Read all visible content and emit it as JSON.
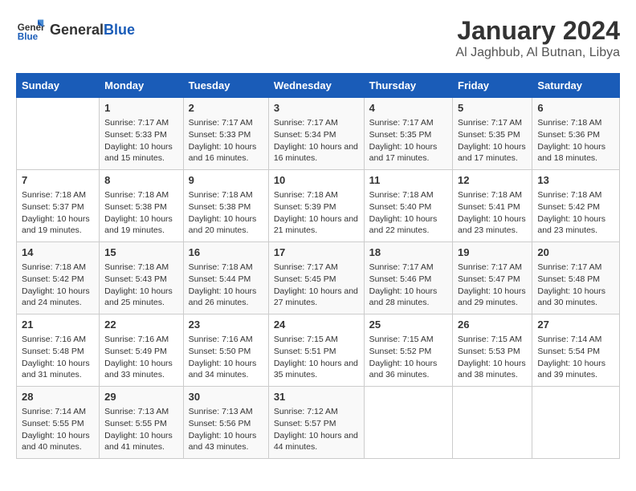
{
  "logo": {
    "text_general": "General",
    "text_blue": "Blue"
  },
  "title": "January 2024",
  "subtitle": "Al Jaghbub, Al Butnan, Libya",
  "header_days": [
    "Sunday",
    "Monday",
    "Tuesday",
    "Wednesday",
    "Thursday",
    "Friday",
    "Saturday"
  ],
  "weeks": [
    [
      {
        "day": "",
        "sunrise": "",
        "sunset": "",
        "daylight": ""
      },
      {
        "day": "1",
        "sunrise": "Sunrise: 7:17 AM",
        "sunset": "Sunset: 5:33 PM",
        "daylight": "Daylight: 10 hours and 15 minutes."
      },
      {
        "day": "2",
        "sunrise": "Sunrise: 7:17 AM",
        "sunset": "Sunset: 5:33 PM",
        "daylight": "Daylight: 10 hours and 16 minutes."
      },
      {
        "day": "3",
        "sunrise": "Sunrise: 7:17 AM",
        "sunset": "Sunset: 5:34 PM",
        "daylight": "Daylight: 10 hours and 16 minutes."
      },
      {
        "day": "4",
        "sunrise": "Sunrise: 7:17 AM",
        "sunset": "Sunset: 5:35 PM",
        "daylight": "Daylight: 10 hours and 17 minutes."
      },
      {
        "day": "5",
        "sunrise": "Sunrise: 7:17 AM",
        "sunset": "Sunset: 5:35 PM",
        "daylight": "Daylight: 10 hours and 17 minutes."
      },
      {
        "day": "6",
        "sunrise": "Sunrise: 7:18 AM",
        "sunset": "Sunset: 5:36 PM",
        "daylight": "Daylight: 10 hours and 18 minutes."
      }
    ],
    [
      {
        "day": "7",
        "sunrise": "Sunrise: 7:18 AM",
        "sunset": "Sunset: 5:37 PM",
        "daylight": "Daylight: 10 hours and 19 minutes."
      },
      {
        "day": "8",
        "sunrise": "Sunrise: 7:18 AM",
        "sunset": "Sunset: 5:38 PM",
        "daylight": "Daylight: 10 hours and 19 minutes."
      },
      {
        "day": "9",
        "sunrise": "Sunrise: 7:18 AM",
        "sunset": "Sunset: 5:38 PM",
        "daylight": "Daylight: 10 hours and 20 minutes."
      },
      {
        "day": "10",
        "sunrise": "Sunrise: 7:18 AM",
        "sunset": "Sunset: 5:39 PM",
        "daylight": "Daylight: 10 hours and 21 minutes."
      },
      {
        "day": "11",
        "sunrise": "Sunrise: 7:18 AM",
        "sunset": "Sunset: 5:40 PM",
        "daylight": "Daylight: 10 hours and 22 minutes."
      },
      {
        "day": "12",
        "sunrise": "Sunrise: 7:18 AM",
        "sunset": "Sunset: 5:41 PM",
        "daylight": "Daylight: 10 hours and 23 minutes."
      },
      {
        "day": "13",
        "sunrise": "Sunrise: 7:18 AM",
        "sunset": "Sunset: 5:42 PM",
        "daylight": "Daylight: 10 hours and 23 minutes."
      }
    ],
    [
      {
        "day": "14",
        "sunrise": "Sunrise: 7:18 AM",
        "sunset": "Sunset: 5:42 PM",
        "daylight": "Daylight: 10 hours and 24 minutes."
      },
      {
        "day": "15",
        "sunrise": "Sunrise: 7:18 AM",
        "sunset": "Sunset: 5:43 PM",
        "daylight": "Daylight: 10 hours and 25 minutes."
      },
      {
        "day": "16",
        "sunrise": "Sunrise: 7:18 AM",
        "sunset": "Sunset: 5:44 PM",
        "daylight": "Daylight: 10 hours and 26 minutes."
      },
      {
        "day": "17",
        "sunrise": "Sunrise: 7:17 AM",
        "sunset": "Sunset: 5:45 PM",
        "daylight": "Daylight: 10 hours and 27 minutes."
      },
      {
        "day": "18",
        "sunrise": "Sunrise: 7:17 AM",
        "sunset": "Sunset: 5:46 PM",
        "daylight": "Daylight: 10 hours and 28 minutes."
      },
      {
        "day": "19",
        "sunrise": "Sunrise: 7:17 AM",
        "sunset": "Sunset: 5:47 PM",
        "daylight": "Daylight: 10 hours and 29 minutes."
      },
      {
        "day": "20",
        "sunrise": "Sunrise: 7:17 AM",
        "sunset": "Sunset: 5:48 PM",
        "daylight": "Daylight: 10 hours and 30 minutes."
      }
    ],
    [
      {
        "day": "21",
        "sunrise": "Sunrise: 7:16 AM",
        "sunset": "Sunset: 5:48 PM",
        "daylight": "Daylight: 10 hours and 31 minutes."
      },
      {
        "day": "22",
        "sunrise": "Sunrise: 7:16 AM",
        "sunset": "Sunset: 5:49 PM",
        "daylight": "Daylight: 10 hours and 33 minutes."
      },
      {
        "day": "23",
        "sunrise": "Sunrise: 7:16 AM",
        "sunset": "Sunset: 5:50 PM",
        "daylight": "Daylight: 10 hours and 34 minutes."
      },
      {
        "day": "24",
        "sunrise": "Sunrise: 7:15 AM",
        "sunset": "Sunset: 5:51 PM",
        "daylight": "Daylight: 10 hours and 35 minutes."
      },
      {
        "day": "25",
        "sunrise": "Sunrise: 7:15 AM",
        "sunset": "Sunset: 5:52 PM",
        "daylight": "Daylight: 10 hours and 36 minutes."
      },
      {
        "day": "26",
        "sunrise": "Sunrise: 7:15 AM",
        "sunset": "Sunset: 5:53 PM",
        "daylight": "Daylight: 10 hours and 38 minutes."
      },
      {
        "day": "27",
        "sunrise": "Sunrise: 7:14 AM",
        "sunset": "Sunset: 5:54 PM",
        "daylight": "Daylight: 10 hours and 39 minutes."
      }
    ],
    [
      {
        "day": "28",
        "sunrise": "Sunrise: 7:14 AM",
        "sunset": "Sunset: 5:55 PM",
        "daylight": "Daylight: 10 hours and 40 minutes."
      },
      {
        "day": "29",
        "sunrise": "Sunrise: 7:13 AM",
        "sunset": "Sunset: 5:55 PM",
        "daylight": "Daylight: 10 hours and 41 minutes."
      },
      {
        "day": "30",
        "sunrise": "Sunrise: 7:13 AM",
        "sunset": "Sunset: 5:56 PM",
        "daylight": "Daylight: 10 hours and 43 minutes."
      },
      {
        "day": "31",
        "sunrise": "Sunrise: 7:12 AM",
        "sunset": "Sunset: 5:57 PM",
        "daylight": "Daylight: 10 hours and 44 minutes."
      },
      {
        "day": "",
        "sunrise": "",
        "sunset": "",
        "daylight": ""
      },
      {
        "day": "",
        "sunrise": "",
        "sunset": "",
        "daylight": ""
      },
      {
        "day": "",
        "sunrise": "",
        "sunset": "",
        "daylight": ""
      }
    ]
  ]
}
